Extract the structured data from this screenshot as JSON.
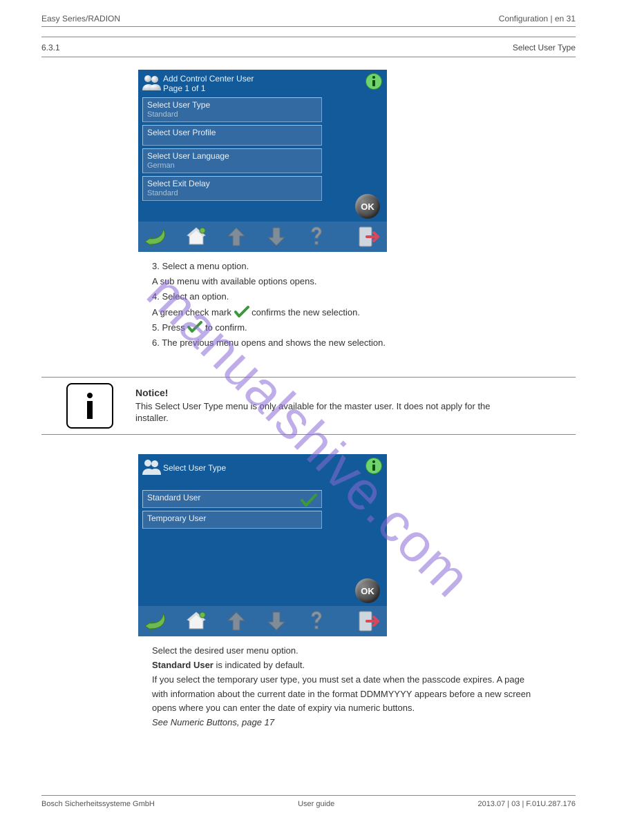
{
  "header": {
    "left": "Easy Series/RADION",
    "right": "Configuration | en  31"
  },
  "subheader": {
    "left": "6.3.1",
    "right": "Select User Type"
  },
  "screen1": {
    "title": "Add Control Center User",
    "page": "Page 1 of 1",
    "rows": [
      {
        "label": "Select User Type",
        "value": "Standard"
      },
      {
        "label": "Select User Profile",
        "value": ""
      },
      {
        "label": "Select User Language",
        "value": "German"
      },
      {
        "label": "Select Exit Delay",
        "value": "Standard"
      }
    ],
    "ok": "OK"
  },
  "list_after_screen1": {
    "items": [
      "Select a menu option.",
      "A sub menu with available options opens.",
      "Select an option.",
      {
        "pre": "A green check mark",
        "post": "confirms the new selection."
      },
      {
        "pre": "Press",
        "post": "to confirm.",
        "button": "OK"
      },
      "The previous menu opens and shows the new selection."
    ],
    "numbers": [
      "3.",
      "4.",
      "5.",
      "6."
    ]
  },
  "note": {
    "heading": "Notice!",
    "body1": "This Select User Type menu is only available for the master user. It does not apply for the",
    "body2": "installer."
  },
  "screen2": {
    "title": "Select User Type",
    "rows": [
      {
        "label": "Standard User",
        "checked": true
      },
      {
        "label": "Temporary User",
        "checked": false
      }
    ],
    "ok": "OK"
  },
  "tail_paragraphs": [
    "Select the desired user menu option.",
    {
      "pre": "Standard User",
      "post": " is indicated by default."
    },
    "If you select the temporary user type, you must set a date when the passcode expires. A page",
    "with information about the current date in the format DDMMYYYY appears before a new screen",
    "opens where you can enter the date of expiry via numeric buttons.",
    "See Numeric Buttons, page 17"
  ],
  "footer": {
    "left": "Bosch Sicherheitssysteme GmbH",
    "center": "User guide",
    "right": "2013.07 | 03 | F.01U.287.176"
  },
  "watermark": "manualshive.com"
}
